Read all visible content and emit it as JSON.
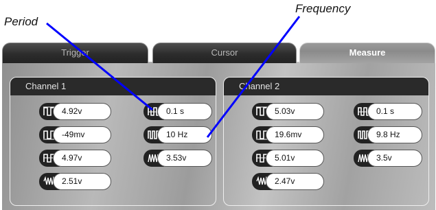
{
  "callouts": {
    "period": "Period",
    "frequency": "Frequency"
  },
  "tabs": [
    {
      "label": "Trigger",
      "active": false
    },
    {
      "label": "Cursor",
      "active": false
    },
    {
      "label": "Measure",
      "active": true
    }
  ],
  "channel1": {
    "title": "Channel 1",
    "items": [
      {
        "icon": "max-voltage-icon",
        "value": "4.92v"
      },
      {
        "icon": "min-voltage-icon",
        "value": "-49mv"
      },
      {
        "icon": "average-voltage-icon",
        "value": "4.97v"
      },
      {
        "icon": "rms-voltage-icon",
        "value": "2.51v"
      },
      {
        "icon": "period-icon",
        "value": "0.1 s"
      },
      {
        "icon": "frequency-icon",
        "value": "10 Hz"
      },
      {
        "icon": "peak-to-peak-icon",
        "value": "3.53v"
      }
    ]
  },
  "channel2": {
    "title": "Channel 2",
    "items": [
      {
        "icon": "max-voltage-icon",
        "value": "5.03v"
      },
      {
        "icon": "min-voltage-icon",
        "value": "19.6mv"
      },
      {
        "icon": "average-voltage-icon",
        "value": "5.01v"
      },
      {
        "icon": "rms-voltage-icon",
        "value": "2.47v"
      },
      {
        "icon": "period-icon",
        "value": "0.1 s"
      },
      {
        "icon": "frequency-icon",
        "value": "9.8 Hz"
      },
      {
        "icon": "peak-to-peak-icon",
        "value": "3.5v"
      }
    ]
  },
  "colors": {
    "annotation_line": "#0000ff",
    "panel_dark": "#2a2a2a"
  }
}
